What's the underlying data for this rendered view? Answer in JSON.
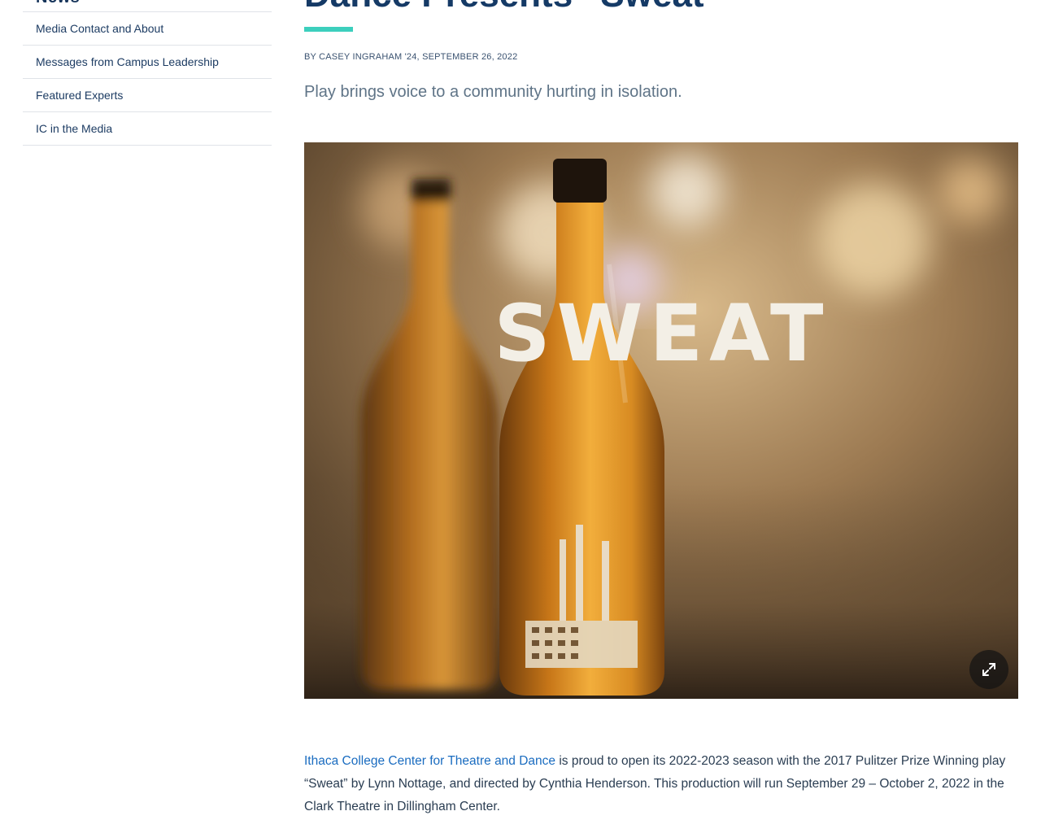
{
  "sidebar": {
    "cut_off_label": "News",
    "items": [
      {
        "label": "Media Contact and About"
      },
      {
        "label": "Messages from Campus Leadership"
      },
      {
        "label": "Featured Experts"
      },
      {
        "label": "IC in the Media"
      }
    ]
  },
  "article": {
    "title": "Dance Presents “Sweat”",
    "byline": "By Casey Ingraham '24, September 26, 2022",
    "subtitle": "Play brings voice to a community hurting in isolation.",
    "hero": {
      "poster_text": "SWEAT",
      "expand_icon": "expand-icon"
    },
    "body": {
      "link_text": "Ithaca College Center for Theatre and Dance",
      "rest": " is proud to open its 2022-2023 season with the 2017 Pulitzer Prize Winning play “Sweat” by Lynn Nottage, and directed by Cynthia Henderson. This production will run September 29 – October 2, 2022 in the Clark Theatre in Dillingham Center."
    }
  },
  "colors": {
    "title": "#153a66",
    "accent_rule": "#3ccfbd",
    "link": "#1a6cc0",
    "sidebar_text": "#1d3c63"
  }
}
